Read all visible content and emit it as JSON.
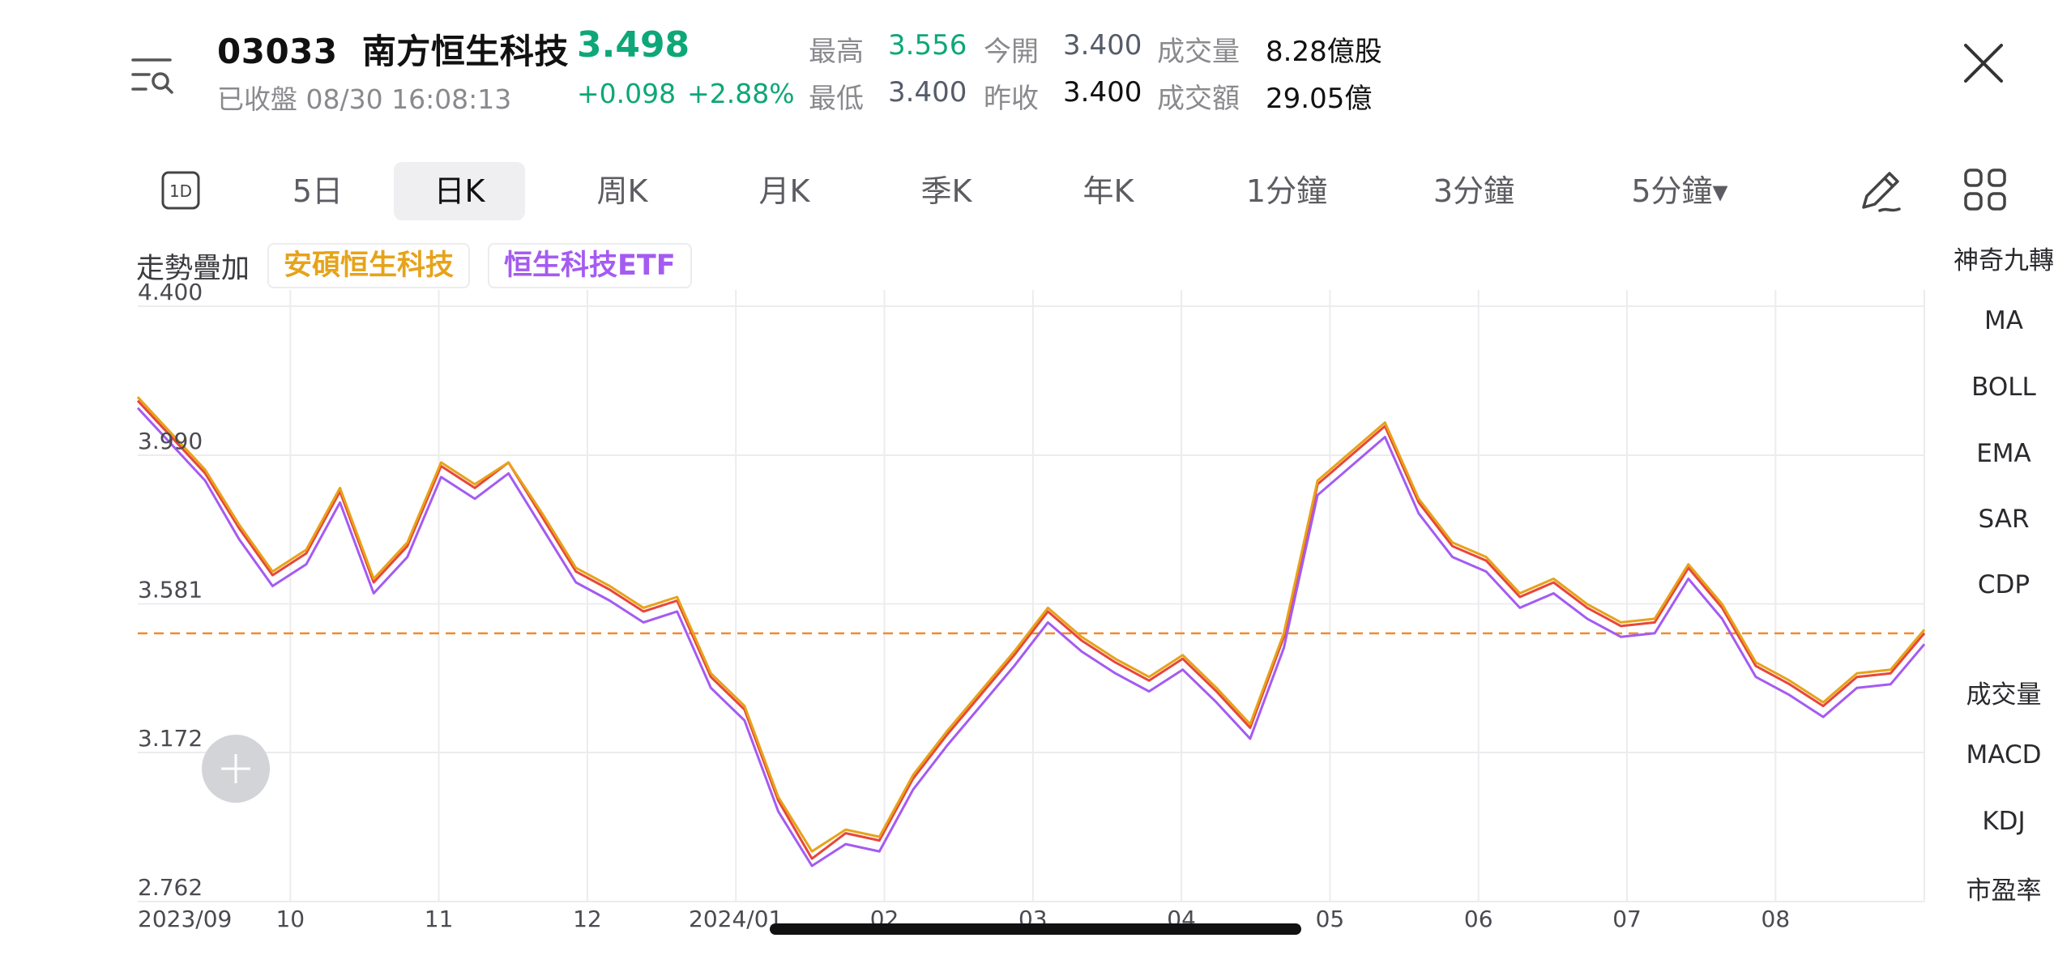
{
  "header": {
    "code": "03033",
    "name": "南方恒生科技",
    "price": "3.498",
    "status": "已收盤 08/30 16:08:13",
    "change": "+0.098",
    "change_pct": "+2.88%",
    "stats": {
      "high_label": "最高",
      "high": "3.556",
      "open_label": "今開",
      "open": "3.400",
      "volume_label": "成交量",
      "volume": "8.28億股",
      "low_label": "最低",
      "low": "3.400",
      "prev_close_label": "昨收",
      "prev_close": "3.400",
      "turnover_label": "成交額",
      "turnover": "29.05億"
    }
  },
  "tabs": [
    {
      "label": "5日"
    },
    {
      "label": "日K",
      "active": true
    },
    {
      "label": "周K"
    },
    {
      "label": "月K"
    },
    {
      "label": "季K"
    },
    {
      "label": "年K"
    },
    {
      "label": "1分鐘"
    },
    {
      "label": "3分鐘"
    },
    {
      "label": "5分鐘▾"
    }
  ],
  "tab_1d_label": "1D",
  "overlay": {
    "label": "走勢疊加",
    "chips": [
      "安碩恒生科技",
      "恒生科技ETF"
    ]
  },
  "side_menu": [
    "神奇九轉",
    "MA",
    "BOLL",
    "EMA",
    "SAR",
    "CDP",
    "成交量",
    "MACD",
    "KDJ",
    "市盈率"
  ],
  "icons": [
    "menu-search-icon",
    "close-icon",
    "calendar-1d-icon",
    "pen-icon",
    "grid-icon",
    "plus-icon"
  ],
  "colors": {
    "up_green": "#0ea777",
    "series_red": "#e8463a",
    "series_gold": "#e6a31a",
    "series_purple": "#a45bf2",
    "reference_line": "#f28b2c"
  },
  "chart_data": {
    "type": "line",
    "y_ticks": [
      "4.400",
      "3.990",
      "3.581",
      "3.172",
      "2.762"
    ],
    "ylim": [
      2.762,
      4.4
    ],
    "x_ticks": [
      "2023/09",
      "10",
      "11",
      "12",
      "2024/01",
      "02",
      "03",
      "04",
      "05",
      "06",
      "07",
      "08"
    ],
    "reference_line": 3.5,
    "x": [
      "2023-09",
      "2023-09",
      "2023-09",
      "2023-10",
      "2023-10",
      "2023-10",
      "2023-10",
      "2023-10",
      "2023-11",
      "2023-11",
      "2023-11",
      "2023-11",
      "2023-11",
      "2023-12",
      "2023-12",
      "2023-12",
      "2023-12",
      "2024-01",
      "2024-01",
      "2024-01",
      "2024-01",
      "2024-01",
      "2024-02",
      "2024-02",
      "2024-02",
      "2024-02",
      "2024-03",
      "2024-03",
      "2024-03",
      "2024-03",
      "2024-03",
      "2024-04",
      "2024-04",
      "2024-04",
      "2024-04",
      "2024-05",
      "2024-05",
      "2024-05",
      "2024-05",
      "2024-05",
      "2024-06",
      "2024-06",
      "2024-06",
      "2024-06",
      "2024-07",
      "2024-07",
      "2024-07",
      "2024-07",
      "2024-07",
      "2024-08",
      "2024-08",
      "2024-08",
      "2024-08",
      "2024-08"
    ],
    "series": [
      {
        "values": [
          4.14,
          4.04,
          3.94,
          3.79,
          3.66,
          3.72,
          3.89,
          3.64,
          3.74,
          3.96,
          3.9,
          3.97,
          3.82,
          3.67,
          3.62,
          3.56,
          3.59,
          3.38,
          3.29,
          3.04,
          2.88,
          2.95,
          2.93,
          3.1,
          3.22,
          3.33,
          3.44,
          3.56,
          3.48,
          3.42,
          3.37,
          3.43,
          3.34,
          3.24,
          3.49,
          3.91,
          3.99,
          4.07,
          3.86,
          3.74,
          3.7,
          3.6,
          3.64,
          3.57,
          3.52,
          3.53,
          3.68,
          3.57,
          3.41,
          3.36,
          3.3,
          3.38,
          3.39,
          3.5
        ]
      },
      {
        "values": [
          4.15,
          4.05,
          3.95,
          3.8,
          3.67,
          3.73,
          3.9,
          3.65,
          3.75,
          3.97,
          3.91,
          3.97,
          3.83,
          3.68,
          3.63,
          3.57,
          3.6,
          3.39,
          3.3,
          3.05,
          2.9,
          2.96,
          2.94,
          3.11,
          3.23,
          3.34,
          3.45,
          3.57,
          3.49,
          3.43,
          3.38,
          3.44,
          3.35,
          3.25,
          3.5,
          3.92,
          4.0,
          4.08,
          3.87,
          3.75,
          3.71,
          3.61,
          3.65,
          3.58,
          3.53,
          3.54,
          3.69,
          3.58,
          3.42,
          3.37,
          3.31,
          3.39,
          3.4,
          3.51
        ]
      },
      {
        "values": [
          4.12,
          4.02,
          3.92,
          3.76,
          3.63,
          3.69,
          3.86,
          3.61,
          3.71,
          3.93,
          3.87,
          3.94,
          3.79,
          3.64,
          3.59,
          3.53,
          3.56,
          3.35,
          3.26,
          3.01,
          2.86,
          2.92,
          2.9,
          3.07,
          3.19,
          3.3,
          3.41,
          3.53,
          3.45,
          3.39,
          3.34,
          3.4,
          3.31,
          3.21,
          3.46,
          3.88,
          3.96,
          4.04,
          3.83,
          3.71,
          3.67,
          3.57,
          3.61,
          3.54,
          3.49,
          3.5,
          3.65,
          3.54,
          3.38,
          3.33,
          3.27,
          3.35,
          3.36,
          3.47
        ]
      }
    ]
  }
}
